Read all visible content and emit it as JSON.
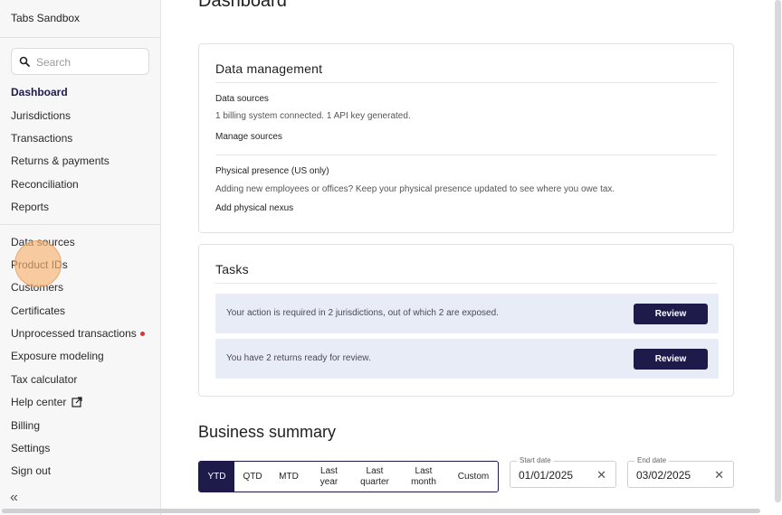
{
  "app": {
    "title": "Tabs Sandbox"
  },
  "search": {
    "placeholder": "Search"
  },
  "sidebar": {
    "primary": [
      {
        "label": "Dashboard",
        "active": true
      },
      {
        "label": "Jurisdictions"
      },
      {
        "label": "Transactions"
      },
      {
        "label": "Returns & payments"
      },
      {
        "label": "Reconciliation"
      },
      {
        "label": "Reports"
      }
    ],
    "secondary": [
      {
        "label": "Data sources"
      },
      {
        "label": "Product IDs"
      },
      {
        "label": "Customers"
      },
      {
        "label": "Certificates"
      },
      {
        "label": "Unprocessed transactions",
        "badge": "red-dot"
      },
      {
        "label": "Exposure modeling"
      },
      {
        "label": "Tax calculator"
      },
      {
        "label": "Help center",
        "icon": "external-link-icon"
      },
      {
        "label": "Billing"
      },
      {
        "label": "Settings"
      },
      {
        "label": "Sign out"
      }
    ],
    "collapse_icon": "«"
  },
  "main": {
    "page_title": "Dashboard",
    "data_management": {
      "title": "Data management",
      "data_sources": {
        "label": "Data sources",
        "description": "1 billing system connected. 1 API key generated.",
        "link": "Manage sources"
      },
      "physical_presence": {
        "label": "Physical presence (US only)",
        "description": "Adding new employees or offices? Keep your physical presence updated to see where you owe tax.",
        "link": "Add physical nexus"
      }
    },
    "tasks": {
      "title": "Tasks",
      "items": [
        {
          "text": "Your action is required in 2 jurisdictions, out of which 2 are exposed.",
          "button": "Review"
        },
        {
          "text": "You have 2 returns ready for review.",
          "button": "Review"
        }
      ]
    },
    "business_summary": {
      "title": "Business summary",
      "periods": [
        "YTD",
        "QTD",
        "MTD",
        "Last\nyear",
        "Last\nquarter",
        "Last\nmonth",
        "Custom"
      ],
      "selected_period": "YTD",
      "start_date": {
        "label": "Start date",
        "value": "01/01/2025"
      },
      "end_date": {
        "label": "End date",
        "value": "03/02/2025"
      }
    }
  },
  "colors": {
    "accent": "#1e1b4b",
    "task_bg": "#e8ecf6",
    "badge": "#dd3333"
  }
}
